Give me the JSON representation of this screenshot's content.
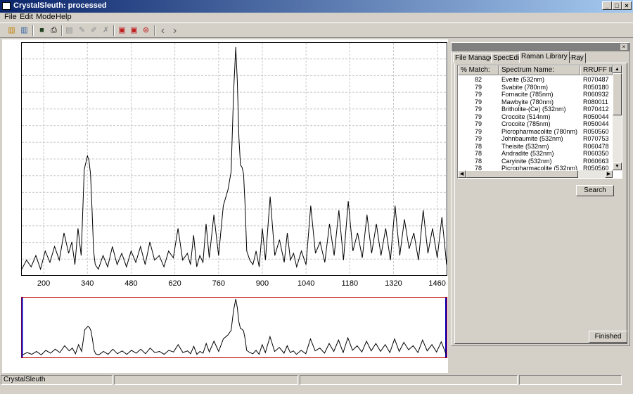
{
  "window": {
    "title": "CrystalSleuth: processed",
    "controls": [
      "_",
      "□",
      "×"
    ]
  },
  "menu": [
    "File",
    "Edit",
    "Mode",
    "Help"
  ],
  "toolbar": {
    "buttons": [
      {
        "name": "spectrum-view-icon",
        "glyph": "▥"
      },
      {
        "name": "spectrum-compare-icon",
        "glyph": "▥"
      },
      {
        "name": "save-icon",
        "glyph": "■"
      },
      {
        "name": "print-icon",
        "glyph": "⎙"
      },
      {
        "name": "edit-table-icon",
        "glyph": "▤"
      },
      {
        "name": "pencil-icon",
        "glyph": "✎"
      },
      {
        "name": "erase-icon",
        "glyph": "✐"
      },
      {
        "name": "cut-icon",
        "glyph": "✗"
      },
      {
        "name": "peak-icon",
        "glyph": "▣"
      },
      {
        "name": "peak-adjust-icon",
        "glyph": "▣"
      },
      {
        "name": "lifebuoy-icon",
        "glyph": "⊛"
      },
      {
        "name": "back-arrow-icon",
        "glyph": "‹"
      },
      {
        "name": "forward-arrow-icon",
        "glyph": "›"
      }
    ]
  },
  "chart_data": {
    "type": "line",
    "title": "",
    "xlabel": "",
    "ylabel": "",
    "xlim": [
      130,
      1490
    ],
    "ylim": [
      0,
      100
    ],
    "grid": true,
    "xticks": [
      200,
      340,
      480,
      620,
      760,
      900,
      1040,
      1180,
      1320,
      1460
    ],
    "series": [
      {
        "x": [
          130,
          145,
          160,
          175,
          190,
          205,
          220,
          235,
          250,
          265,
          280,
          290,
          300,
          310,
          320,
          330,
          340,
          345,
          350,
          355,
          360,
          365,
          375,
          390,
          405,
          420,
          435,
          450,
          465,
          480,
          495,
          510,
          525,
          540,
          555,
          570,
          585,
          600,
          615,
          630,
          645,
          660,
          670,
          680,
          690,
          700,
          710,
          720,
          730,
          745,
          760,
          775,
          790,
          800,
          808,
          815,
          820,
          825,
          830,
          835,
          840,
          845,
          850,
          860,
          870,
          880,
          890,
          900,
          910,
          925,
          940,
          955,
          970,
          980,
          990,
          1000,
          1010,
          1025,
          1040,
          1055,
          1070,
          1085,
          1100,
          1115,
          1130,
          1145,
          1160,
          1175,
          1190,
          1205,
          1220,
          1235,
          1250,
          1265,
          1280,
          1295,
          1310,
          1325,
          1340,
          1355,
          1370,
          1385,
          1400,
          1415,
          1430,
          1445,
          1460,
          1475,
          1490
        ],
        "values": [
          2,
          6,
          3,
          8,
          2,
          10,
          5,
          12,
          6,
          18,
          9,
          14,
          4,
          20,
          8,
          46,
          52,
          50,
          44,
          28,
          10,
          4,
          2,
          8,
          3,
          12,
          4,
          9,
          3,
          10,
          5,
          12,
          4,
          14,
          6,
          8,
          3,
          10,
          7,
          20,
          6,
          9,
          4,
          17,
          3,
          8,
          5,
          22,
          7,
          26,
          8,
          30,
          37,
          45,
          80,
          100,
          85,
          60,
          48,
          47,
          44,
          30,
          10,
          6,
          4,
          10,
          3,
          20,
          6,
          34,
          8,
          15,
          5,
          18,
          6,
          9,
          3,
          10,
          4,
          30,
          9,
          14,
          5,
          22,
          8,
          28,
          6,
          32,
          10,
          18,
          7,
          26,
          9,
          22,
          8,
          20,
          6,
          30,
          8,
          24,
          11,
          18,
          6,
          28,
          9,
          20,
          7,
          25,
          4
        ]
      }
    ]
  },
  "panel": {
    "tabs": [
      "File Manager",
      "SpecEdit",
      "Raman Library",
      "X-Ray"
    ],
    "active_tab": "Raman Library",
    "columns": [
      "% Match:",
      "Spectrum Name:",
      "RRUFF ID:"
    ],
    "rows": [
      {
        "match": "82",
        "name": "Eveite (532nm)",
        "id": "R070487"
      },
      {
        "match": "79",
        "name": "Svabite (780nm)",
        "id": "R050180"
      },
      {
        "match": "79",
        "name": "Fornacite (785nm)",
        "id": "R060932"
      },
      {
        "match": "79",
        "name": "Mawbyite (780nm)",
        "id": "R080011"
      },
      {
        "match": "79",
        "name": "Britholite-(Ce) (532nm)",
        "id": "R070412"
      },
      {
        "match": "79",
        "name": "Crocoite (514nm)",
        "id": "R050044"
      },
      {
        "match": "79",
        "name": "Crocoite (785nm)",
        "id": "R050044"
      },
      {
        "match": "79",
        "name": "Picropharmacolite (780nm)",
        "id": "R050560"
      },
      {
        "match": "79",
        "name": "Johnbaumite (532nm)",
        "id": "R070753"
      },
      {
        "match": "78",
        "name": "Theisite (532nm)",
        "id": "R060478"
      },
      {
        "match": "78",
        "name": "Andradite (532nm)",
        "id": "R060350"
      },
      {
        "match": "78",
        "name": "Caryinite (532nm)",
        "id": "R060663"
      },
      {
        "match": "78",
        "name": "Picropharmacolite (532nm)",
        "id": "R050560"
      }
    ],
    "search_label": "Search",
    "finished_label": "Finished"
  },
  "statusbar": {
    "text": "CrystalSleuth"
  }
}
